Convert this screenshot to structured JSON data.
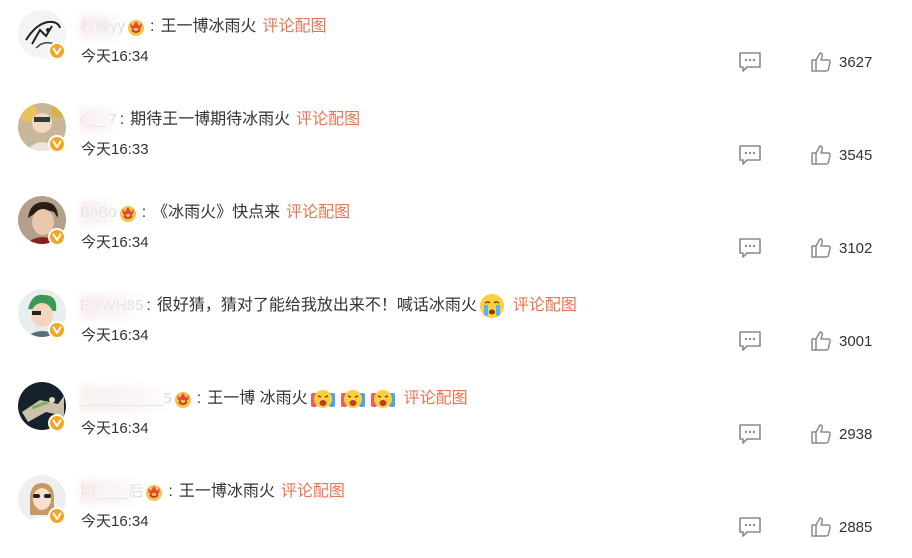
{
  "comments": [
    {
      "user": "杉峰yy",
      "text": "王一博冰雨火",
      "link": "评论配图",
      "time": "今天16:34",
      "likes": "3627",
      "crown": true,
      "avatar_icon": "sketch-avatar",
      "emojis": []
    },
    {
      "user": "c__ 7",
      "text": "期待王一博期待冰雨火",
      "link": "评论配图",
      "time": "今天16:33",
      "likes": "3545",
      "crown": false,
      "avatar_icon": "photo-avatar",
      "emojis": []
    },
    {
      "user": "BoBo",
      "text": "《冰雨火》快点来",
      "link": "评论配图",
      "time": "今天16:34",
      "likes": "3102",
      "crown": true,
      "avatar_icon": "portrait-avatar",
      "emojis": []
    },
    {
      "user": "EGWH85",
      "text": "很好猜，猜对了能给我放出来不！喊话冰雨火",
      "link": "评论配图",
      "time": "今天16:34",
      "likes": "3001",
      "crown": false,
      "avatar_icon": "anime-avatar",
      "emojis": [
        "crying-emoji"
      ]
    },
    {
      "user": "__________5",
      "text": "王一博 冰雨火",
      "link": "评论配图",
      "time": "今天16:34",
      "likes": "2938",
      "crown": true,
      "avatar_icon": "dark-avatar",
      "emojis": [
        "cheering-emoji",
        "cheering-emoji",
        "cheering-emoji"
      ]
    },
    {
      "user": "期____后",
      "text": "王一博冰雨火",
      "link": "评论配图",
      "time": "今天16:34",
      "likes": "2885",
      "crown": true,
      "avatar_icon": "girl-avatar",
      "emojis": []
    }
  ],
  "colors": {
    "link": "#eb7350",
    "verified_badge": "#f5a623",
    "icon_gray": "#8a8a8a",
    "text": "#333333"
  },
  "icons": {
    "reply": "comment-icon",
    "like": "thumbs-up-icon",
    "verified": "verified-badge-icon",
    "crown": "crown-badge-icon"
  }
}
